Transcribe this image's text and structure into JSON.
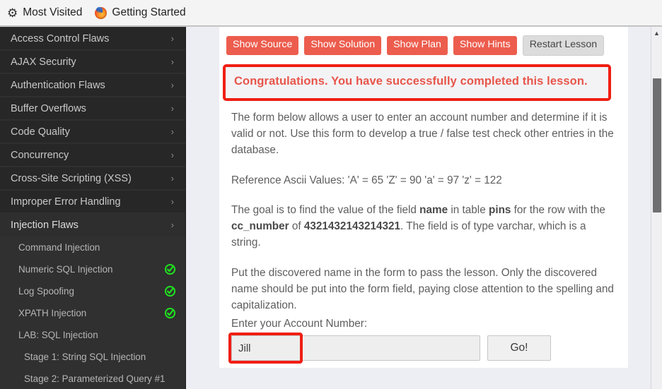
{
  "bookmarks_bar": {
    "items": [
      {
        "label": "Most Visited",
        "icon": "gear-icon"
      },
      {
        "label": "Getting Started",
        "icon": "firefox-logo-icon"
      }
    ]
  },
  "sidebar": {
    "categories": [
      {
        "label": "Access Control Flaws",
        "chevron": "›",
        "active": false
      },
      {
        "label": "AJAX Security",
        "chevron": "›",
        "active": false
      },
      {
        "label": "Authentication Flaws",
        "chevron": "›",
        "active": false
      },
      {
        "label": "Buffer Overflows",
        "chevron": "›",
        "active": false
      },
      {
        "label": "Code Quality",
        "chevron": "›",
        "active": false
      },
      {
        "label": "Concurrency",
        "chevron": "›",
        "active": false
      },
      {
        "label": "Cross-Site Scripting (XSS)",
        "chevron": "›",
        "active": false
      },
      {
        "label": "Improper Error Handling",
        "chevron": "›",
        "active": false
      },
      {
        "label": "Injection Flaws",
        "chevron": "›",
        "active": true
      }
    ],
    "lessons": [
      {
        "label": "Command Injection",
        "completed": false,
        "indent": 1
      },
      {
        "label": "Numeric SQL Injection",
        "completed": true,
        "indent": 1
      },
      {
        "label": "Log Spoofing",
        "completed": true,
        "indent": 1
      },
      {
        "label": "XPATH Injection",
        "completed": true,
        "indent": 1
      },
      {
        "label": "LAB: SQL Injection",
        "completed": false,
        "indent": 1
      },
      {
        "label": "Stage 1: String SQL Injection",
        "completed": false,
        "indent": 2
      },
      {
        "label": "Stage 2: Parameterized Query #1",
        "completed": false,
        "indent": 2
      }
    ],
    "completed_icon_color": "#1fe01f"
  },
  "toolbar": {
    "buttons": [
      {
        "label": "Show Source",
        "style": "red"
      },
      {
        "label": "Show Solution",
        "style": "red"
      },
      {
        "label": "Show Plan",
        "style": "red"
      },
      {
        "label": "Show Hints",
        "style": "red"
      },
      {
        "label": "Restart Lesson",
        "style": "gray"
      }
    ],
    "red_color": "#ec5d4e",
    "gray_color": "#dcdcdc"
  },
  "banner": {
    "text": "Congratulations. You have successfully completed this lesson.",
    "text_color": "#e8554a",
    "annotation_color": "#f01e13"
  },
  "lesson": {
    "paragraph_1": "The form below allows a user to enter an account number and determine if it is valid or not. Use this form to develop a true / false test check other entries in the database.",
    "paragraph_2": "Reference Ascii Values: 'A' = 65 'Z' = 90 'a' = 97 'z' = 122",
    "paragraph_3": {
      "part_1": "The goal is to find the value of the field ",
      "bold_1": "name",
      "part_2": " in table ",
      "bold_2": "pins",
      "part_3": " for the row with the ",
      "bold_3": "cc_number",
      "part_4": " of ",
      "bold_4": "4321432143214321",
      "part_5": ". The field is of type varchar, which is a string."
    },
    "paragraph_4": "Put the discovered name in the form to pass the lesson. Only the discovered name should be put into the form field, paying close attention to the spelling and capitalization."
  },
  "form": {
    "label": "Enter your Account Number:",
    "input_value": "Jill",
    "input_placeholder": "",
    "submit_label": "Go!"
  },
  "scrollbar": {
    "up_arrow_glyph": "▲"
  }
}
